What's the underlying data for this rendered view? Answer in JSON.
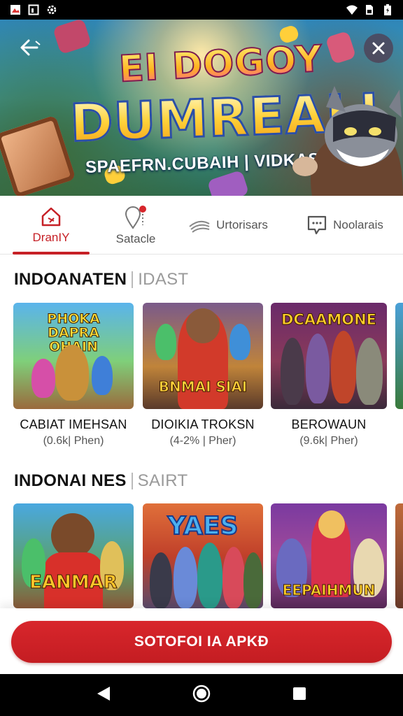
{
  "hero": {
    "title_line1": "EI DOGOY",
    "title_line2": "DUMREALI",
    "subtitle": "SPAEFRN.CUBAIH | VIDKASI"
  },
  "tabs": [
    {
      "label": "DranIY",
      "icon": "home-icon",
      "active": true
    },
    {
      "label": "Satacle",
      "icon": "location-pin-icon",
      "active": false
    },
    {
      "label": "Urtorisars",
      "icon": "wifi-waves-icon",
      "active": false
    },
    {
      "label": "Noolarais",
      "icon": "chat-bubble-icon",
      "active": false
    }
  ],
  "sections": [
    {
      "title": "INDOANATEN",
      "tag": "IDAST",
      "items": [
        {
          "thumb_title": "PHOKA DAPRA OHAIN",
          "name": "CABIAT IMEHSAN",
          "meta": "(0.6k| Phen)"
        },
        {
          "thumb_title": "BNMAI SIAI",
          "name": "DIOIKIA TROKSN",
          "meta": "(4-2% | Pher)"
        },
        {
          "thumb_title": "DCAAMONE",
          "name": "BEROWAUN",
          "meta": "(9.6k| Pher)"
        }
      ]
    },
    {
      "title": "INDONAI NES",
      "tag": "SAIRT",
      "items": [
        {
          "thumb_title": "EANMAR",
          "name": "",
          "meta": ""
        },
        {
          "thumb_title": "YAES",
          "name": "",
          "meta": ""
        },
        {
          "thumb_title": "EEPAIHMUN",
          "name": "",
          "meta": ""
        }
      ]
    }
  ],
  "cta": {
    "label": "SOTOFOI IA APKĐ"
  },
  "colors": {
    "accent": "#c62026",
    "status_bar": "#000000"
  }
}
